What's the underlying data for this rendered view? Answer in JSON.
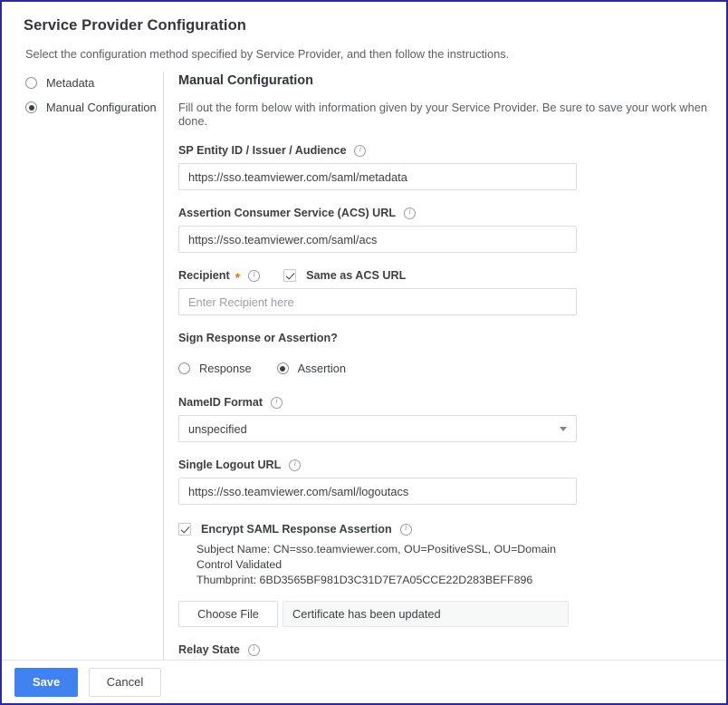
{
  "header": {
    "title": "Service Provider Configuration",
    "subtitle": "Select the configuration method specified by Service Provider, and then follow the instructions."
  },
  "method_options": [
    {
      "label": "Metadata",
      "selected": false
    },
    {
      "label": "Manual Configuration",
      "selected": true
    }
  ],
  "manual": {
    "title": "Manual Configuration",
    "description": "Fill out the form below with information given by your Service Provider. Be sure to save your work when done."
  },
  "fields": {
    "sp_entity": {
      "label": "SP Entity ID / Issuer / Audience",
      "info": "info-icon",
      "value": "https://sso.teamviewer.com/saml/metadata"
    },
    "acs_url": {
      "label": "Assertion Consumer Service (ACS) URL",
      "info": "info-icon",
      "value": "https://sso.teamviewer.com/saml/acs"
    },
    "recipient": {
      "label": "Recipient",
      "required_marker": "*",
      "info": "info-icon",
      "same_as_acs_label": "Same as ACS URL",
      "same_as_acs_checked": true,
      "placeholder": "Enter Recipient here",
      "value": ""
    },
    "sign": {
      "label": "Sign Response or Assertion?",
      "options": [
        {
          "label": "Response",
          "selected": false
        },
        {
          "label": "Assertion",
          "selected": true
        }
      ]
    },
    "nameid": {
      "label": "NameID Format",
      "info": "info-icon",
      "value": "unspecified"
    },
    "slo_url": {
      "label": "Single Logout URL",
      "info": "info-icon",
      "value": "https://sso.teamviewer.com/saml/logoutacs"
    },
    "encrypt": {
      "label": "Encrypt SAML Response Assertion",
      "info": "info-icon",
      "checked": true,
      "subject_name": "Subject Name: CN=sso.teamviewer.com, OU=PositiveSSL, OU=Domain Control Validated",
      "thumbprint": "Thumbprint: 6BD3565BF981D3C31D7E7A05CCE22D283BEFF896"
    },
    "certificate": {
      "choose_file_label": "Choose File",
      "file_status": "Certificate has been updated"
    },
    "relay_state": {
      "label": "Relay State",
      "info": "info-icon",
      "value": ""
    }
  },
  "footer": {
    "save_label": "Save",
    "cancel_label": "Cancel"
  },
  "colors": {
    "accent_blue": "#3f82f0",
    "required_orange": "#e8710a",
    "page_border": "#2a2a9c"
  }
}
